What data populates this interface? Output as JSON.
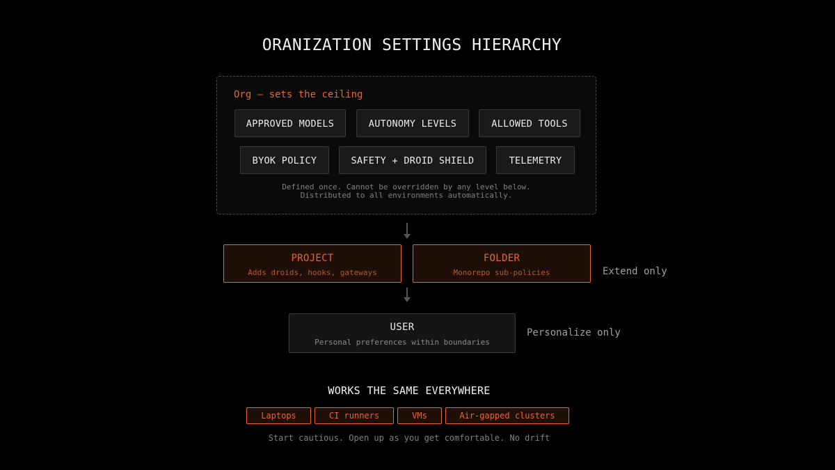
{
  "title": "ORANIZATION SETTINGS HIERARCHY",
  "org": {
    "label": "Org — sets the ceiling",
    "chips_row1": [
      "APPROVED MODELS",
      "AUTONOMY LEVELS",
      "ALLOWED TOOLS"
    ],
    "chips_row2": [
      "BYOK POLICY",
      "SAFETY + DROID SHIELD",
      "TELEMETRY"
    ],
    "note_line1": "Defined once. Cannot be overridden by any level below.",
    "note_line2": "Distributed to all environments automatically."
  },
  "project": {
    "title": "PROJECT",
    "subtitle": "Adds droids, hooks, gateways"
  },
  "folder": {
    "title": "FOLDER",
    "subtitle": "Monorepo sub-policies"
  },
  "extend_note": "Extend only",
  "user": {
    "title": "USER",
    "subtitle": "Personal preferences within boundaries"
  },
  "personalize_note": "Personalize only",
  "environments": {
    "title": "WORKS THE SAME EVERYWHERE",
    "items": [
      "Laptops",
      "CI runners",
      "VMs",
      "Air-gapped clusters"
    ]
  },
  "footer": "Start cautious. Open up as you get comfortable. No drift",
  "colors": {
    "background": "#000000",
    "accent": "#e8672e",
    "chip_bg": "#1a1a1a",
    "border_gray": "#3a3a3a"
  }
}
